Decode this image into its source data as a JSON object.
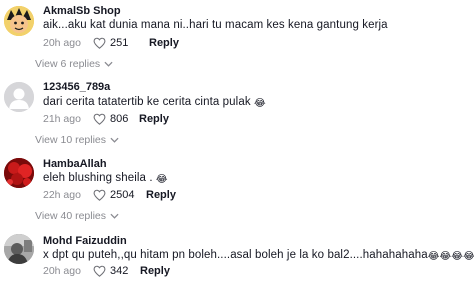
{
  "comments": [
    {
      "username": "AkmalSb Shop",
      "text": "aik...aku kat dunia mana ni..hari tu macam kes kena gantung kerja",
      "time": "20h ago",
      "likes": "251",
      "reply_label": "Reply",
      "view_replies": "View 6 replies"
    },
    {
      "username": "123456_789a",
      "text": "dari cerita tatatertib ke cerita cinta pulak",
      "emoji": "😂",
      "time": "21h ago",
      "likes": "806",
      "reply_label": "Reply",
      "view_replies": "View 10 replies"
    },
    {
      "username": "HambaAllah",
      "text": "eleh blushing sheila .",
      "emoji": "😂",
      "time": "22h ago",
      "likes": "2504",
      "reply_label": "Reply",
      "view_replies": "View 40 replies"
    },
    {
      "username": "Mohd Faizuddin",
      "text": "x dpt qu puteh,,qu hitam pn boleh....asal boleh je la ko bal2....hahahahaha",
      "emoji": "😂😂😂😂😂",
      "time": "20h ago",
      "likes": "342",
      "reply_label": "Reply"
    }
  ],
  "icons": {
    "like": "heart-outline-icon",
    "expand": "chevron-down-icon"
  },
  "colors": {
    "text_primary": "#161823",
    "text_secondary": "#8a8b91"
  }
}
